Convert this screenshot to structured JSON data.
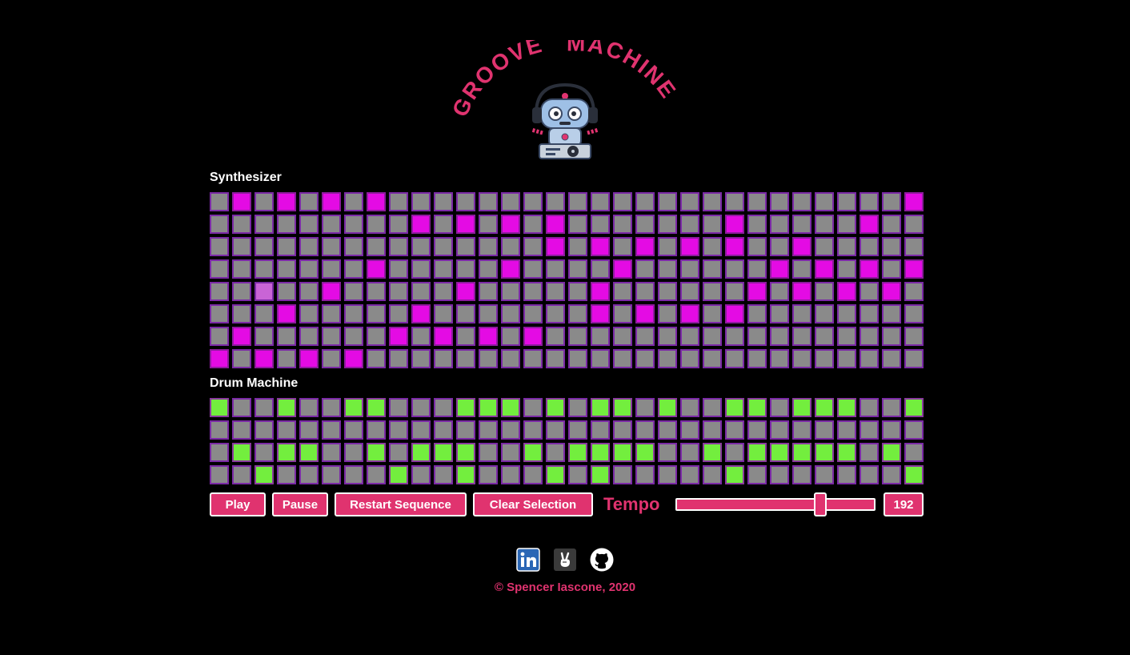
{
  "logo": {
    "title_left": "GROOVE",
    "title_right": "MACHINE"
  },
  "colors": {
    "accent": "#e0336f",
    "synth_on": "#e40be4",
    "drum_on": "#73ee3e",
    "cell_off": "#8a8a8a",
    "cell_border": "#7b2aa6"
  },
  "synth": {
    "label": "Synthesizer",
    "rows": [
      "01010101000000000000000000000001",
      "00000000010101010000000100000100",
      "00000000000000010101010100100000",
      "00000001000001000010000001010101",
      "00000100000100000100000010101010",
      "00010000010000000101010100000000",
      "01000000101010100000000000000000",
      "10101010000000000000000000000000"
    ],
    "playhead_index": 2,
    "playhead_row": 4
  },
  "drums": {
    "label": "Drum Machine",
    "rows": [
      "10010011000111010110100110111001",
      "00000000000000000000000000000000",
      "01011001011100101111001011111010",
      "00100000100100010100000100000001"
    ]
  },
  "controls": {
    "play_label": "Play",
    "pause_label": "Pause",
    "restart_label": "Restart Sequence",
    "clear_label": "Clear Selection",
    "tempo_label": "Tempo",
    "tempo_value": "192",
    "tempo_fraction": 0.74
  },
  "social": [
    {
      "name": "linkedin",
      "icon": "linkedin-icon"
    },
    {
      "name": "angellist",
      "icon": "angellist-icon"
    },
    {
      "name": "github",
      "icon": "github-icon"
    }
  ],
  "footer": {
    "copyright": "© Spencer Iascone, 2020"
  }
}
